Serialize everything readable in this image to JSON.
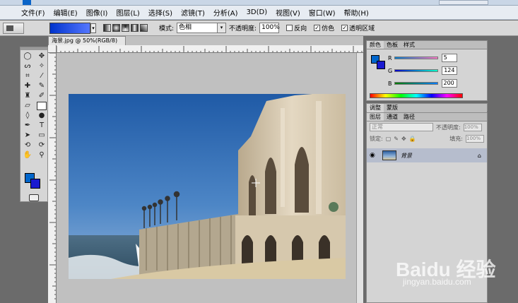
{
  "menu": [
    "文件(F)",
    "编辑(E)",
    "图像(I)",
    "图层(L)",
    "选择(S)",
    "滤镜(T)",
    "分析(A)",
    "3D(D)",
    "视图(V)",
    "窗口(W)",
    "帮助(H)"
  ],
  "options": {
    "mode_label": "模式:",
    "mode_value": "色相",
    "opacity_label": "不透明度:",
    "opacity_value": "100%",
    "reverse_label": "反向",
    "dither_label": "仿色",
    "transparency_label": "透明区域"
  },
  "document": {
    "tab_title": "海景.jpg @ 50%(RGB/8)",
    "tab_close": "×"
  },
  "color_panel": {
    "tabs": [
      "颜色",
      "色板",
      "样式"
    ],
    "r_label": "R",
    "r_value": "5",
    "g_label": "G",
    "g_value": "124",
    "b_label": "B",
    "b_value": "200"
  },
  "adjust_panel": {
    "tabs": [
      "调整",
      "蒙版"
    ]
  },
  "layers_panel": {
    "tabs": [
      "图层",
      "通道",
      "路径"
    ],
    "blend_mode": "正常",
    "opacity_label": "不透明度:",
    "opacity_value": "100%",
    "lock_label": "锁定:",
    "fill_label": "填充:",
    "fill_value": "100%",
    "layer_name": "背景"
  },
  "watermark": {
    "brand": "Baidu 经验",
    "url": "jingyan.baidu.com"
  },
  "colors": {
    "foreground": "#0066cc",
    "background": "#1a1ad0",
    "accent": "#0a64c8"
  }
}
